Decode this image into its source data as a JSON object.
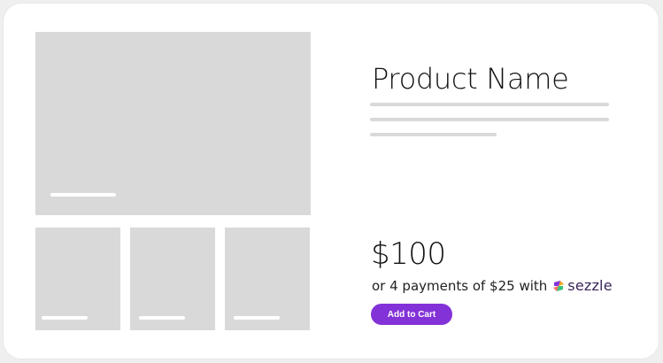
{
  "product": {
    "name": "Product Name",
    "price": "$100",
    "installments_text": "or 4 payments of $25 with",
    "payment_provider": "sezzle",
    "add_to_cart_label": "Add to Cart"
  },
  "gallery": {
    "main_image": "product-image-placeholder",
    "thumbnails": [
      "thumbnail-placeholder",
      "thumbnail-placeholder",
      "thumbnail-placeholder"
    ]
  },
  "colors": {
    "placeholder": "#d9d9d9",
    "button": "#8332d8",
    "sezzle_text": "#392558",
    "sezzle_icon_orange": "#f5a623",
    "sezzle_icon_purple": "#8332d8",
    "sezzle_icon_green": "#35c57a"
  }
}
